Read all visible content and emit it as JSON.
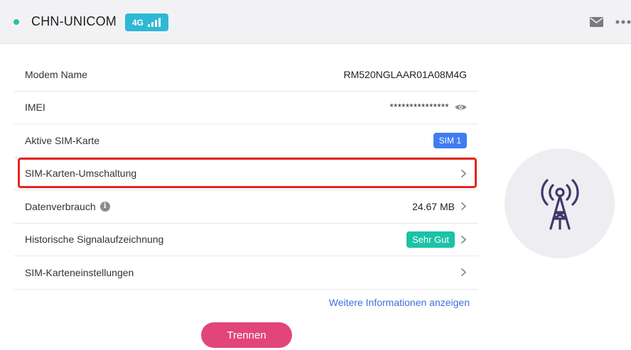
{
  "header": {
    "operator": "CHN-UNICOM",
    "network_type": "4G",
    "icons": [
      "status-dot",
      "signal-bars-icon",
      "mail-icon",
      "more-icon"
    ]
  },
  "colors": {
    "accent_teal": "#26c0a8",
    "badge_blue": "#2eb8d4",
    "sim_blue": "#3f7cf2",
    "signal_green": "#1cc2a6",
    "link_blue": "#3f6fe0",
    "button_pink": "#e2457a",
    "highlight_red": "#e5261e"
  },
  "rows": [
    {
      "label": "Modem Name",
      "value": "RM520NGLAAR01A08M4G"
    },
    {
      "label": "IMEI",
      "value": "***************"
    },
    {
      "label": "Aktive SIM-Karte",
      "value": "SIM 1"
    },
    {
      "label": "SIM-Karten-Umschaltung"
    },
    {
      "label": "Datenverbrauch",
      "value": "24.67 MB"
    },
    {
      "label": "Historische Signalaufzeichnung",
      "value": "Sehr Gut"
    },
    {
      "label": "SIM-Karteneinstellungen"
    }
  ],
  "more_link": "Weitere Informationen anzeigen",
  "disconnect_button": "Trennen"
}
